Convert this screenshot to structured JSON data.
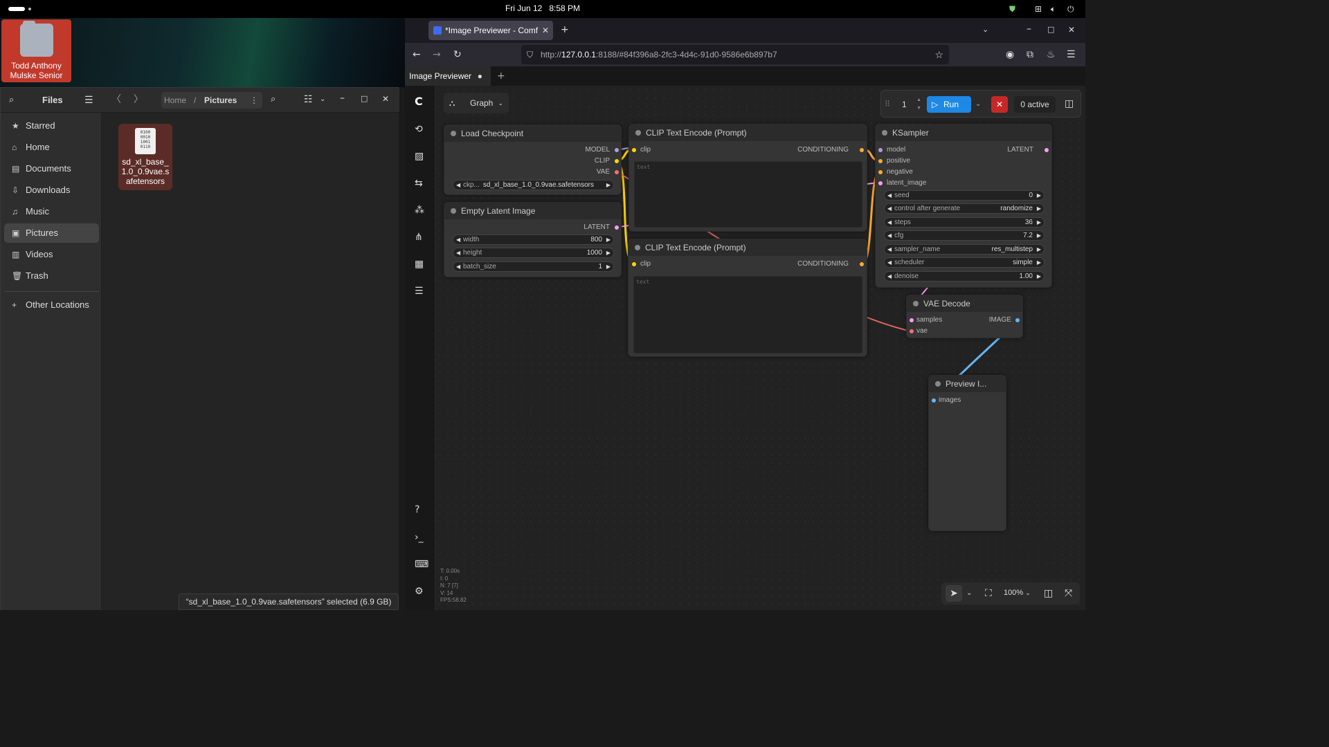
{
  "topbar": {
    "date": "Fri Jun 12",
    "time": "8:58 PM"
  },
  "desktop": {
    "icon_label": "Todd Anthony Mulske Senior"
  },
  "files": {
    "title": "Files",
    "breadcrumb": [
      "Home",
      "Pictures"
    ],
    "sidebar": [
      {
        "label": "Starred",
        "icon": "star-icon"
      },
      {
        "label": "Home",
        "icon": "home-icon"
      },
      {
        "label": "Documents",
        "icon": "document-icon"
      },
      {
        "label": "Downloads",
        "icon": "download-icon"
      },
      {
        "label": "Music",
        "icon": "music-icon"
      },
      {
        "label": "Pictures",
        "icon": "picture-icon"
      },
      {
        "label": "Videos",
        "icon": "video-icon"
      },
      {
        "label": "Trash",
        "icon": "trash-icon"
      },
      {
        "label": "Other Locations",
        "icon": "plus-icon"
      }
    ],
    "active_item": "Pictures",
    "file": {
      "name": "sd_xl_base_1.0_0.9vae.safetensors",
      "icon_text": "0100 0010 1001 0110"
    },
    "status": "“sd_xl_base_1.0_0.9vae.safetensors” selected  (6.9 GB)"
  },
  "browser": {
    "tab_title": "*Image Previewer - Comf",
    "url_prefix": "http://",
    "url_host": "127.0.0.1",
    "url_rest": ":8188/#84f396a8-2fc3-4d4c-91d0-9586e6b897b7"
  },
  "comfy": {
    "workflow_tab": "Image Previewer",
    "graph_label": "Graph",
    "queue_count": "1",
    "run_label": "Run",
    "active_label": "0 active",
    "zoom": "100%",
    "stats": [
      "T: 0.00s",
      "I: 0",
      "N: 7 [7]",
      "V: 14",
      "FPS:58.82"
    ],
    "nodes": {
      "load_checkpoint": {
        "title": "Load Checkpoint",
        "outputs": [
          "MODEL",
          "CLIP",
          "VAE"
        ],
        "ckpt_label": "ckp...",
        "ckpt_value": "sd_xl_base_1.0_0.9vae.safetensors"
      },
      "empty_latent": {
        "title": "Empty Latent Image",
        "output": "LATENT",
        "widgets": [
          {
            "label": "width",
            "value": "800"
          },
          {
            "label": "height",
            "value": "1000"
          },
          {
            "label": "batch_size",
            "value": "1"
          }
        ]
      },
      "clip_pos": {
        "title": "CLIP Text Encode (Prompt)",
        "input": "clip",
        "output": "CONDITIONING",
        "placeholder": "text"
      },
      "clip_neg": {
        "title": "CLIP Text Encode (Prompt)",
        "input": "clip",
        "output": "CONDITIONING",
        "placeholder": "text"
      },
      "ksampler": {
        "title": "KSampler",
        "inputs": [
          "model",
          "positive",
          "negative",
          "latent_image"
        ],
        "output": "LATENT",
        "widgets": [
          {
            "label": "seed",
            "value": "0"
          },
          {
            "label": "control after generate",
            "value": "randomize"
          },
          {
            "label": "steps",
            "value": "36"
          },
          {
            "label": "cfg",
            "value": "7.2"
          },
          {
            "label": "sampler_name",
            "value": "res_multistep"
          },
          {
            "label": "scheduler",
            "value": "simple"
          },
          {
            "label": "denoise",
            "value": "1.00"
          }
        ]
      },
      "vae_decode": {
        "title": "VAE Decode",
        "inputs": [
          "samples",
          "vae"
        ],
        "output": "IMAGE"
      },
      "preview": {
        "title": "Preview I...",
        "input": "images"
      }
    },
    "colors": {
      "clip": "#ffd500",
      "model": "#b39ddb",
      "vae": "#ff6e6e",
      "latent": "#ff9cf9",
      "conditioning": "#ffa931",
      "image": "#64b5f6",
      "run": "#1e88e5"
    }
  }
}
